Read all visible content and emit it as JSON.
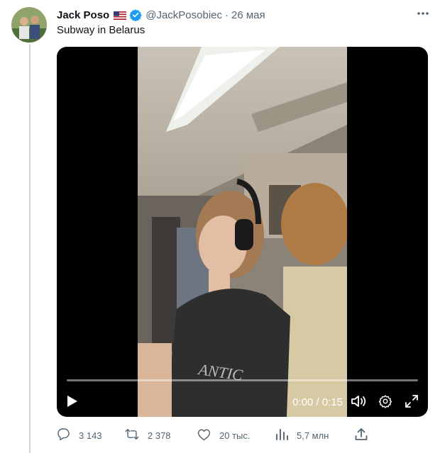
{
  "tweet": {
    "author_name": "Jack Poso",
    "author_handle": "@JackPosobiec",
    "separator": "·",
    "date": "26 мая",
    "text": "Subway in Belarus"
  },
  "video": {
    "time": "0:00 / 0:15",
    "progress": 0
  },
  "actions": {
    "replies": "3 143",
    "retweets": "2 378",
    "likes": "20 тыс.",
    "views": "5,7 млн"
  },
  "icons": [
    "more-icon",
    "verified-icon",
    "us-flag-icon",
    "play-icon",
    "volume-icon",
    "settings-icon",
    "fullscreen-icon",
    "reply-icon",
    "retweet-icon",
    "like-icon",
    "views-icon",
    "share-icon"
  ],
  "colors": {
    "verified": "#1d9bf0",
    "secondary_text": "#536471"
  }
}
